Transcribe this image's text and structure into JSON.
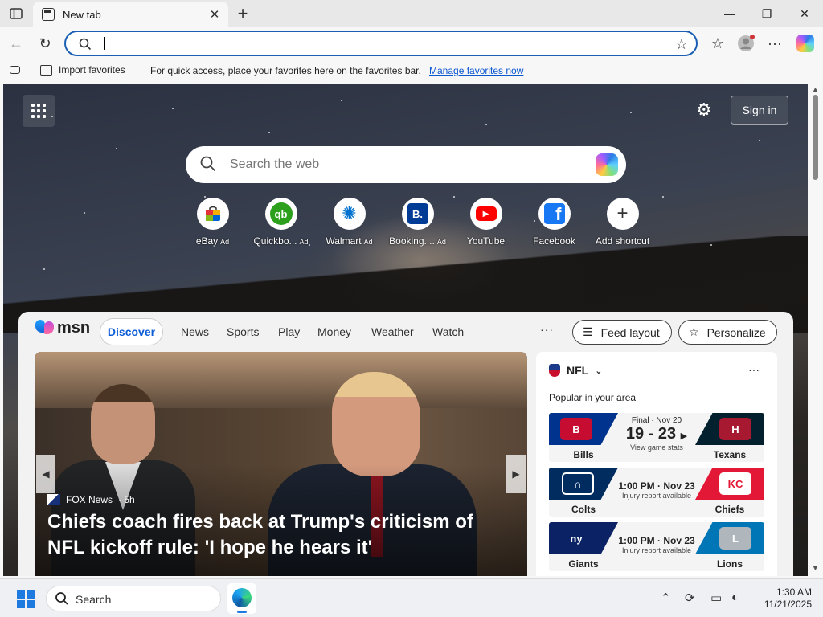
{
  "browser": {
    "tab_title": "New tab",
    "address_value": ""
  },
  "favorites_bar": {
    "import_label": "Import favorites",
    "message": "For quick access, place your favorites here on the favorites bar.",
    "manage_link": "Manage favorites now"
  },
  "newtab": {
    "signin_label": "Sign in",
    "search_placeholder": "Search the web",
    "shortcuts": [
      {
        "label": "eBay",
        "ad": "Ad",
        "icon": "ebay-icon"
      },
      {
        "label": "Quickbo...",
        "ad": "Ad",
        "icon": "quickbooks-icon"
      },
      {
        "label": "Walmart",
        "ad": "Ad",
        "icon": "walmart-icon"
      },
      {
        "label": "Booking....",
        "ad": "Ad",
        "icon": "booking-icon"
      },
      {
        "label": "YouTube",
        "ad": "",
        "icon": "youtube-icon"
      },
      {
        "label": "Facebook",
        "ad": "",
        "icon": "facebook-icon"
      },
      {
        "label": "Add shortcut",
        "ad": "",
        "icon": "plus-icon"
      }
    ]
  },
  "msn": {
    "logo_text": "msn",
    "tabs": [
      "Discover",
      "News",
      "Sports",
      "Play",
      "Money",
      "Weather",
      "Watch"
    ],
    "more": "···",
    "feed_layout": "Feed layout",
    "personalize": "Personalize",
    "hero": {
      "source": "FOX News",
      "age": "· 5h",
      "headline": "Chiefs coach fires back at Trump's criticism of NFL kickoff rule: 'I hope he hears it'"
    },
    "nfl": {
      "title": "NFL",
      "subtitle": "Popular in your area",
      "games": [
        {
          "home": "Bills",
          "away": "Texans",
          "status": "Final · Nov 20",
          "score": "19 - 23",
          "note": "View game stats",
          "home_color": "#00338d",
          "away_color": "#03202f"
        },
        {
          "home": "Colts",
          "away": "Chiefs",
          "status": "",
          "time": "1:00 PM · Nov 23",
          "note": "Injury report available",
          "home_color": "#002c5f",
          "away_color": "#e31837"
        },
        {
          "home": "Giants",
          "away": "Lions",
          "status": "",
          "time": "1:00 PM · Nov 23",
          "note": "Injury report available",
          "home_color": "#0b2265",
          "away_color": "#0076b6"
        }
      ]
    }
  },
  "taskbar": {
    "search_label": "Search",
    "time": "1:30 AM",
    "date": "11/21/2025"
  }
}
